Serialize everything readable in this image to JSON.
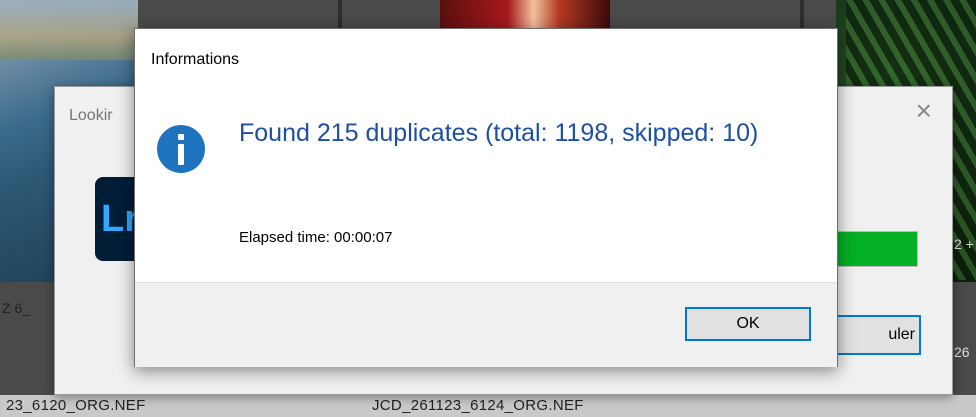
{
  "background": {
    "filenames": [
      "23_6120_ORG.NEF",
      "JCD_261123_6124_ORG.NEF"
    ],
    "left_label": "Z 6_",
    "right_label_top": "2 +",
    "right_label_bottom": "26"
  },
  "back_dialog": {
    "title": "Lookir",
    "close_glyph": "×",
    "app_logo_text": "Lr",
    "cancel_label": "uler",
    "progress_color": "#06b025"
  },
  "dialog": {
    "title": "Informations",
    "icon": "info-icon",
    "message": "Found 215 duplicates (total: 1198, skipped: 10)",
    "elapsed": "Elapsed time: 00:00:07",
    "ok_label": "OK",
    "accent_color": "#0078d7",
    "message_color": "#1e4fa3"
  }
}
